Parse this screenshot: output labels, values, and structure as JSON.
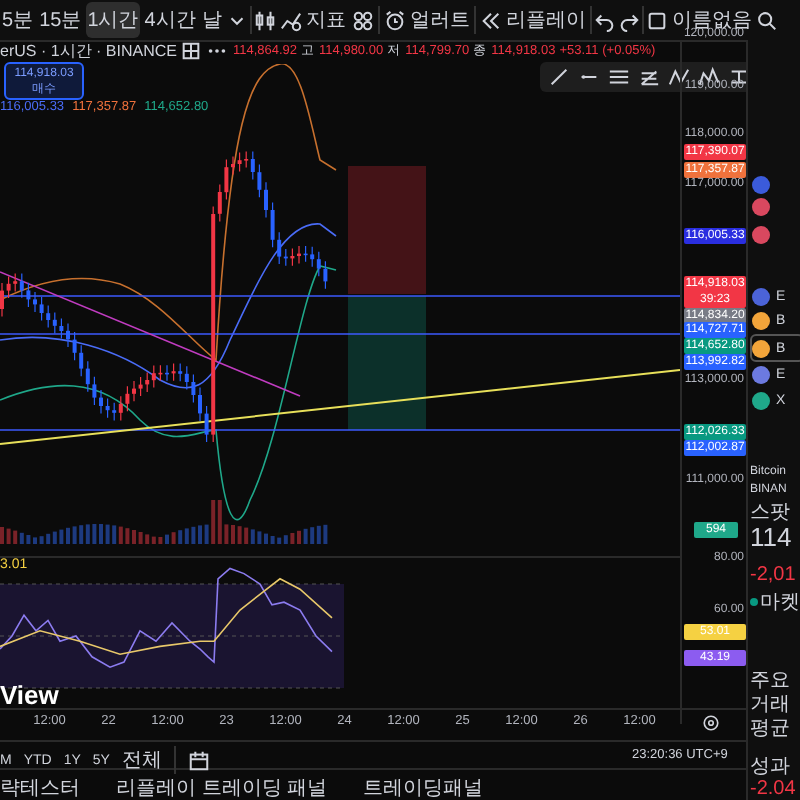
{
  "toolbar": {
    "intervals": [
      {
        "label": "5분",
        "selected": false
      },
      {
        "label": "15분",
        "selected": false
      },
      {
        "label": "1시간",
        "selected": true
      },
      {
        "label": "4시간",
        "selected": false
      },
      {
        "label": "날",
        "selected": false
      }
    ],
    "buttons": [
      {
        "kind": "indicator",
        "label": "지표"
      },
      {
        "kind": "grid"
      },
      {
        "kind": "alert",
        "label": "얼러트"
      },
      {
        "kind": "replay",
        "label": "리플레이"
      }
    ],
    "layout_name": "이름없음"
  },
  "legend": {
    "symbol": "erUS · 1시간 · BINANCE",
    "open": "114,864.92",
    "high_label": "고",
    "high": "114,980.00",
    "low_label": "저",
    "low": "114,799.70",
    "close_label": "종",
    "close": "114,918.03",
    "change": "+53.11 (+0.05%)"
  },
  "buy_box": {
    "price": "114,918.03",
    "label": "매수"
  },
  "indicator_values": [
    {
      "text": "116,005.33",
      "color": "#4a6cf7"
    },
    {
      "text": "117,357.87",
      "color": "#f0723c"
    },
    {
      "text": "114,652.80",
      "color": "#1fa88a"
    }
  ],
  "price_axis": [
    {
      "text": "120,000.00",
      "kind": "tick"
    },
    {
      "text": "119,000.00",
      "kind": "tick"
    },
    {
      "text": "118,000.00",
      "kind": "tick"
    },
    {
      "text": "117,390.07",
      "kind": "badge",
      "color": "#f23645"
    },
    {
      "text": "117,357.87",
      "kind": "badge",
      "color": "#f0723c"
    },
    {
      "text": "117,000.00",
      "kind": "tick"
    },
    {
      "text": "116,005.33",
      "kind": "badge",
      "color": "#2a2ee0"
    },
    {
      "text": "114,918.03",
      "kind": "badge",
      "color": "#f23645",
      "sub": "39:23"
    },
    {
      "text": "114,834.20",
      "kind": "badge",
      "color": "#787b86"
    },
    {
      "text": "114,727.71",
      "kind": "badge",
      "color": "#2962ff"
    },
    {
      "text": "114,652.80",
      "kind": "badge",
      "color": "#089981"
    },
    {
      "text": "113,992.82",
      "kind": "badge",
      "color": "#2962ff"
    },
    {
      "text": "113,000.00",
      "kind": "tick"
    },
    {
      "text": "112,026.33",
      "kind": "badge",
      "color": "#089981"
    },
    {
      "text": "112,002.87",
      "kind": "badge",
      "color": "#2962ff"
    },
    {
      "text": "111,000.00",
      "kind": "tick"
    },
    {
      "text": "594",
      "kind": "badge",
      "color": "#1fa88a"
    }
  ],
  "rsi": {
    "value": "3.01",
    "axis": [
      {
        "text": "80.00",
        "kind": "tick"
      },
      {
        "text": "60.00",
        "kind": "tick"
      },
      {
        "text": "53.01",
        "kind": "badge",
        "color": "#f5d142"
      },
      {
        "text": "43.19",
        "kind": "badge",
        "color": "#8c5cf0"
      }
    ]
  },
  "logo": "View",
  "time_axis": [
    "12:00",
    "22",
    "12:00",
    "23",
    "12:00",
    "24",
    "12:00",
    "25",
    "12:00",
    "26",
    "12:00"
  ],
  "ranges": [
    "M",
    "YTD",
    "1Y",
    "5Y",
    "전체"
  ],
  "clock": "23:20:36 UTC+9",
  "bottom_tabs": [
    "략테스터",
    "리플레이 트레이딩 패널",
    "트레이딩패널"
  ],
  "sidebar": {
    "watchlist": [
      {
        "color": "#3b5bdb",
        "selected": false
      },
      {
        "color": "#d9485f",
        "selected": false
      },
      {
        "color": "#d9485f",
        "selected": false
      },
      {
        "symbol": "E",
        "color": "#4b63d8",
        "selected": false
      },
      {
        "symbol": "B",
        "color": "#f2a43a",
        "selected": false
      },
      {
        "symbol": "B",
        "color": "#f2a43a",
        "selected": true
      },
      {
        "symbol": "E",
        "color": "#6c7ae0",
        "selected": false
      },
      {
        "symbol": "X",
        "color": "#1fa88a",
        "selected": false
      }
    ],
    "name": "Bitcoin",
    "exchange": "BINAN",
    "market": "스팟",
    "price": "114",
    "change": "-2,01",
    "status": "마켓",
    "stats": [
      "주요",
      "거래",
      "평균"
    ],
    "performance_label": "성과",
    "performance": "-2.04"
  }
}
